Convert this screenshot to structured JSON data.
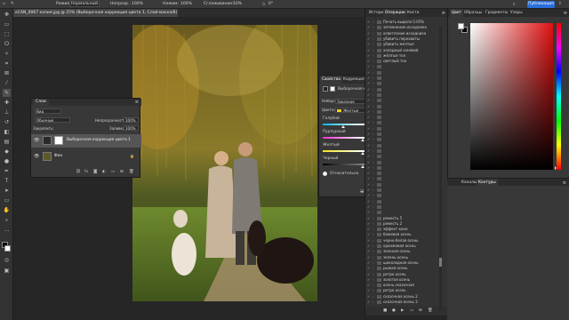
{
  "options": {
    "mode_label": "Режим:",
    "mode_value": "Нормальный",
    "opacity_label": "Непрозр.:",
    "opacity_value": "100%",
    "pressure_label": "Нажим:",
    "pressure_value": "100%",
    "smoothing_label": "Сглаживание:",
    "smoothing_value": "10%",
    "angle_value": "0°",
    "publish_label": "Публикация"
  },
  "document": {
    "tab_title": "eCAN_0067 копия.jpg @ 25% (Выборочная коррекция цвета 1, Слой-маска/8) *"
  },
  "layers_panel": {
    "title": "Слои",
    "filter_label": "Вид",
    "blend_mode": "Обычные",
    "opacity_label": "Непрозрачность:",
    "opacity_value": "100%",
    "lock_label": "Закрепить:",
    "fill_label": "Заливка:",
    "fill_value": "100%",
    "layers": [
      {
        "name": "Выборочная коррекция цвета 1"
      },
      {
        "name": "Фон"
      }
    ]
  },
  "properties_panel": {
    "tabs": [
      "Свойства",
      "Коррекция",
      "Библиотеки"
    ],
    "subtitle": "Выборочная коррекция цвета",
    "preset_label": "Набор:",
    "preset_value": "Заказная",
    "colors_label": "Цвета:",
    "colors_value": "Желтые",
    "sliders": [
      {
        "label": "Голубой",
        "value": "-49",
        "unit": "%",
        "level": -0.49
      },
      {
        "label": "Пурпурный",
        "value": "0",
        "unit": "%",
        "level": 0
      },
      {
        "label": "Желтый",
        "value": "0",
        "unit": "%",
        "level": 0
      },
      {
        "label": "Черный",
        "value": "0",
        "unit": "%",
        "level": 0
      }
    ],
    "method_relative": "Относительно",
    "method_absolute": "Абсолютно"
  },
  "operations_panel": {
    "tabs": [
      "История",
      "Операции",
      "Кисти"
    ],
    "items": [
      "Печать выдела 0.05%",
      "затемнение исходника",
      "осветление исходника",
      "убавить перехваты",
      "убавить желтые",
      "холодный синевой",
      "жёлтые тон",
      "светлый тон",
      "",
      "",
      "",
      "",
      "",
      "",
      "",
      "",
      "",
      "",
      "",
      "",
      "",
      "",
      "",
      "",
      "",
      "",
      "",
      "",
      "",
      "",
      "",
      "",
      "",
      "",
      "",
      "реместь 5",
      "реместь 2",
      "эффект кино",
      "бежевая осень",
      "черно-белая осень",
      "оранжевая осень",
      "зеленая осень",
      "зелень осень",
      "шоколадная осень",
      "рыжая осень",
      "ретро осень",
      "золотая осень",
      "осень сказочная",
      "ретро осень",
      "сказочная осень 2",
      "сказочная осень 3"
    ]
  },
  "color_panel": {
    "tabs": [
      "Цвет",
      "Образцы",
      "Градиенты",
      "Узоры"
    ],
    "hue_color": "#e01010"
  },
  "contours_panel": {
    "tabs": [
      "Каналы",
      "Контуры"
    ]
  }
}
